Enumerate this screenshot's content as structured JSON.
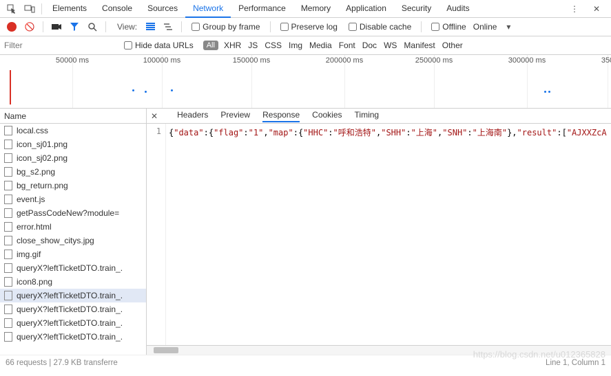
{
  "main_tabs": {
    "items": [
      "Elements",
      "Console",
      "Sources",
      "Network",
      "Performance",
      "Memory",
      "Application",
      "Security",
      "Audits"
    ],
    "active": "Network"
  },
  "toolbar": {
    "view_label": "View:",
    "group_by_frame": "Group by frame",
    "preserve_log": "Preserve log",
    "disable_cache": "Disable cache",
    "offline": "Offline",
    "online": "Online"
  },
  "filters": {
    "placeholder": "Filter",
    "hide_data_urls": "Hide data URLs",
    "all_badge": "All",
    "categories": [
      "XHR",
      "JS",
      "CSS",
      "Img",
      "Media",
      "Font",
      "Doc",
      "WS",
      "Manifest",
      "Other"
    ]
  },
  "timeline": {
    "ticks": [
      "50000 ms",
      "100000 ms",
      "150000 ms",
      "200000 ms",
      "250000 ms",
      "300000 ms",
      "350"
    ]
  },
  "left": {
    "header": "Name",
    "files": [
      {
        "name": "local.css"
      },
      {
        "name": "icon_sj01.png"
      },
      {
        "name": "icon_sj02.png"
      },
      {
        "name": "bg_s2.png"
      },
      {
        "name": "bg_return.png"
      },
      {
        "name": "event.js"
      },
      {
        "name": "getPassCodeNew?module="
      },
      {
        "name": "error.html"
      },
      {
        "name": "close_show_citys.jpg"
      },
      {
        "name": "img.gif"
      },
      {
        "name": "queryX?leftTicketDTO.train_."
      },
      {
        "name": "icon8.png"
      },
      {
        "name": "queryX?leftTicketDTO.train_.",
        "selected": true
      },
      {
        "name": "queryX?leftTicketDTO.train_."
      },
      {
        "name": "queryX?leftTicketDTO.train_."
      },
      {
        "name": "queryX?leftTicketDTO.train_."
      }
    ]
  },
  "sub_tabs": {
    "items": [
      "Headers",
      "Preview",
      "Response",
      "Cookies",
      "Timing"
    ],
    "active": "Response"
  },
  "response": {
    "line_no": "1",
    "tokens": [
      {
        "t": "{",
        "c": "jp"
      },
      {
        "t": "\"data\"",
        "c": "jk"
      },
      {
        "t": ":",
        "c": "jp"
      },
      {
        "t": "{",
        "c": "jp"
      },
      {
        "t": "\"flag\"",
        "c": "jk"
      },
      {
        "t": ":",
        "c": "jp"
      },
      {
        "t": "\"1\"",
        "c": "js"
      },
      {
        "t": ",",
        "c": "jp"
      },
      {
        "t": "\"map\"",
        "c": "jk"
      },
      {
        "t": ":",
        "c": "jp"
      },
      {
        "t": "{",
        "c": "jp"
      },
      {
        "t": "\"HHC\"",
        "c": "jk"
      },
      {
        "t": ":",
        "c": "jp"
      },
      {
        "t": "\"呼和浩特\"",
        "c": "js"
      },
      {
        "t": ",",
        "c": "jp"
      },
      {
        "t": "\"SHH\"",
        "c": "jk"
      },
      {
        "t": ":",
        "c": "jp"
      },
      {
        "t": "\"上海\"",
        "c": "js"
      },
      {
        "t": ",",
        "c": "jp"
      },
      {
        "t": "\"SNH\"",
        "c": "jk"
      },
      {
        "t": ":",
        "c": "jp"
      },
      {
        "t": "\"上海南\"",
        "c": "js"
      },
      {
        "t": "},",
        "c": "jp"
      },
      {
        "t": "\"result\"",
        "c": "jk"
      },
      {
        "t": ":",
        "c": "jp"
      },
      {
        "t": "[",
        "c": "jp"
      },
      {
        "t": "\"AJXXZcA",
        "c": "js"
      }
    ]
  },
  "status": {
    "left": "66 requests  |  27.9 KB transferre",
    "right": "Line 1, Column 1"
  },
  "watermark": "https://blog.csdn.net/u012365828"
}
